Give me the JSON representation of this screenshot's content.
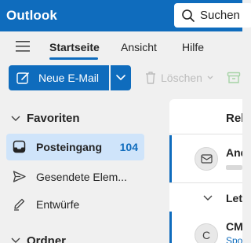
{
  "app": {
    "title": "Outlook"
  },
  "search": {
    "placeholder": "Suchen"
  },
  "tabs": [
    {
      "label": "Startseite",
      "active": true
    },
    {
      "label": "Ansicht",
      "active": false
    },
    {
      "label": "Hilfe",
      "active": false
    }
  ],
  "toolbar": {
    "new_mail_label": "Neue E-Mail",
    "delete_label": "Löschen"
  },
  "sections": {
    "favorites": "Favoriten",
    "folders": "Ordner"
  },
  "folders": [
    {
      "label": "Posteingang",
      "count": "104",
      "icon": "inbox-icon",
      "selected": true
    },
    {
      "label": "Gesendete Elem...",
      "count": "",
      "icon": "send-icon",
      "selected": false
    },
    {
      "label": "Entwürfe",
      "count": "",
      "icon": "drafts-icon",
      "selected": false
    }
  ],
  "message_list": {
    "tab_label": "Rel",
    "first_sender": "And",
    "group_label": "Letz",
    "second_sender": "CM",
    "second_avatar_initial": "C",
    "second_snippet": "Spo"
  },
  "colors": {
    "accent": "#0f6cbd",
    "selected_bg": "#cfe4fa",
    "pane_bg": "#f0f0f0"
  }
}
